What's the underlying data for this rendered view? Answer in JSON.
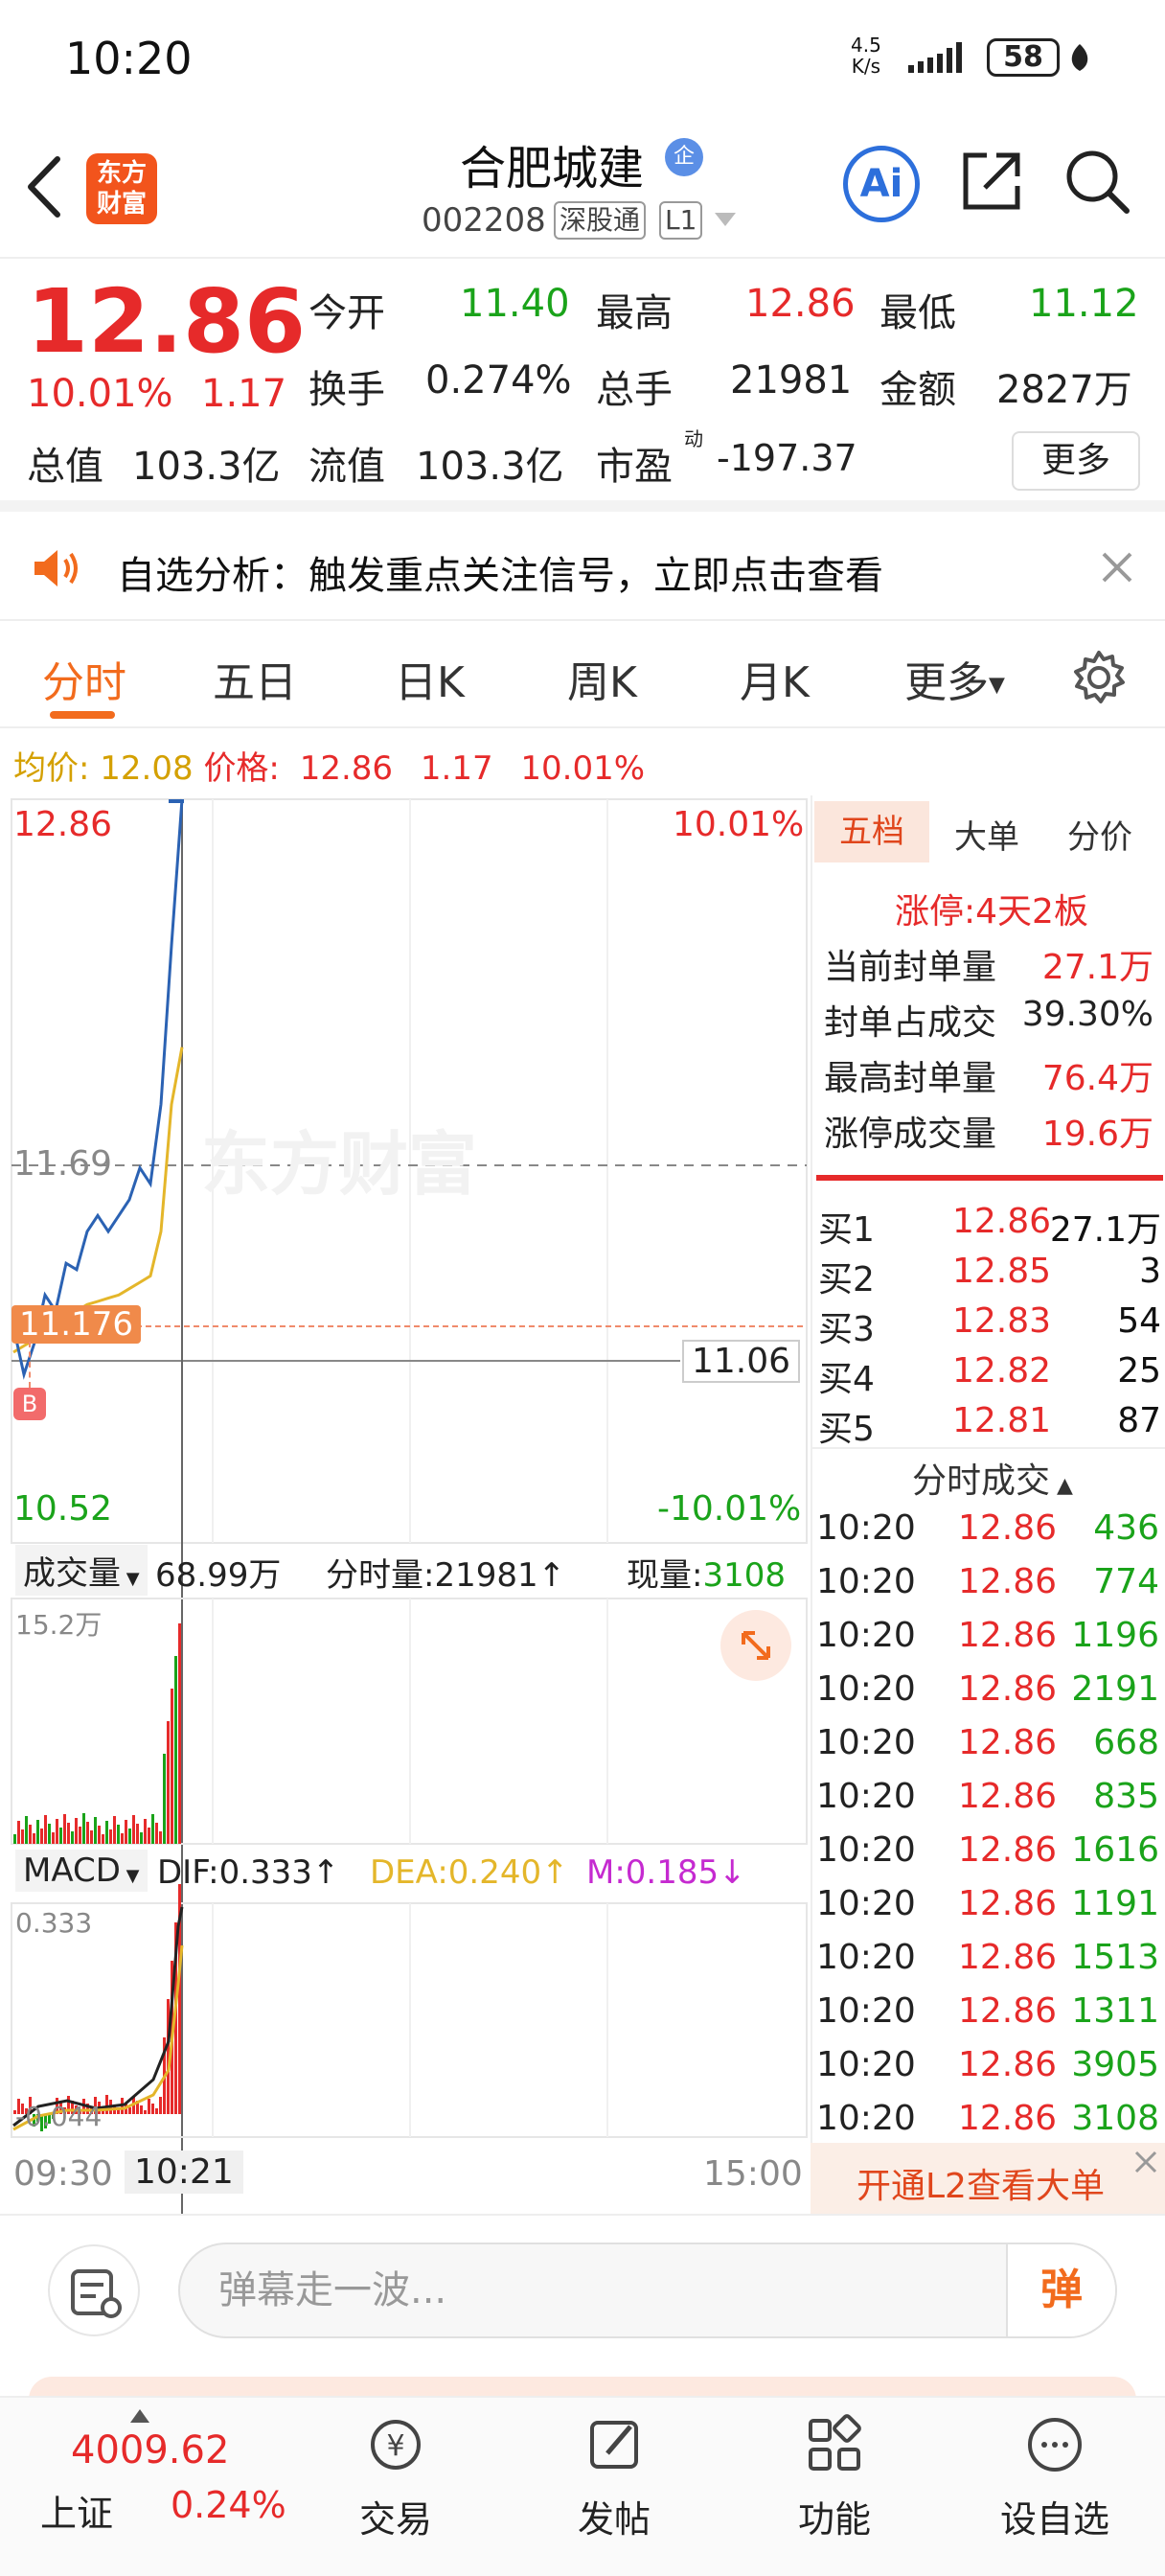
{
  "status_bar": {
    "time": "10:20",
    "net_speed_value": "4.5",
    "net_speed_unit": "K/s",
    "battery": "58"
  },
  "header": {
    "title": "合肥城建",
    "badge": "企",
    "logo_text_line1": "东方",
    "logo_text_line2": "财富",
    "code": "002208",
    "tag1": "深股通",
    "tag2": "L1",
    "ai_label": "Ai"
  },
  "quote": {
    "price": "12.86",
    "change_pct": "10.01%",
    "change": "1.17",
    "fields": {
      "open_label": "今开",
      "open_value": "11.40",
      "high_label": "最高",
      "high_value": "12.86",
      "low_label": "最低",
      "low_value": "11.12",
      "turnover_label": "换手",
      "turnover_value": "0.274%",
      "volume_label": "总手",
      "volume_value": "21981",
      "amount_label": "金额",
      "amount_value": "2827万",
      "total_value_label": "总值",
      "total_value_value": "103.3亿",
      "float_value_label": "流值",
      "float_value_value": "103.3亿",
      "pe_label": "市盈",
      "pe_sup": "动",
      "pe_value": "-197.37"
    },
    "more_button": "更多"
  },
  "notice": {
    "text": "自选分析：触发重点关注信号，立即点击查看"
  },
  "tabs": [
    "分时",
    "五日",
    "日K",
    "周K",
    "月K",
    "更多"
  ],
  "avg_line": {
    "avg_label": "均价:",
    "avg_value": "12.08",
    "price_label": "价格:",
    "price_value": "12.86",
    "chg": "1.17",
    "pct": "10.01%"
  },
  "chart": {
    "price_top": "12.86",
    "pct_top": "10.01%",
    "price_mid": "11.69",
    "price_cursor": "11.176",
    "price_right": "11.06",
    "marker": "B",
    "price_bottom": "10.52",
    "pct_bottom": "-10.01%",
    "watermark": "东方财富",
    "volume_selector": "成交量",
    "volume_total": "68.99万",
    "volume_period_label": "分时量:",
    "volume_period_value": "21981",
    "volume_now_label": "现量:",
    "volume_now_value": "3108",
    "volume_max": "15.2万",
    "macd_selector": "MACD",
    "dif": "DIF:0.333",
    "dea": "DEA:0.240",
    "m": "M:0.185",
    "macd_top": "0.333",
    "macd_bottom": "-0.044",
    "time_start": "09:30",
    "time_cursor": "10:21",
    "time_end": "15:00"
  },
  "chart_data": {
    "type": "line",
    "x_range": [
      "09:30",
      "15:00"
    ],
    "ylim": [
      10.52,
      12.86
    ],
    "price_series_sample": [
      11.2,
      11.05,
      11.15,
      11.3,
      11.25,
      11.4,
      11.38,
      11.5,
      11.55,
      11.5,
      11.55,
      11.6,
      11.7,
      11.65,
      11.9,
      12.4,
      12.86
    ],
    "avg_series_sample": [
      11.12,
      11.14,
      11.16,
      11.2,
      11.22,
      11.24,
      11.25,
      11.27,
      11.28,
      11.29,
      11.3,
      11.32,
      11.34,
      11.36,
      11.5,
      11.9,
      12.08
    ]
  },
  "right_panel": {
    "tabs": [
      "五档",
      "大单",
      "分价"
    ],
    "limit_label": "涨停:",
    "limit_value": "4天2板",
    "stats": [
      {
        "label": "当前封单量",
        "value": "27.1万"
      },
      {
        "label": "封单占成交",
        "value": "39.30%"
      },
      {
        "label": "最高封单量",
        "value": "76.4万"
      },
      {
        "label": "涨停成交量",
        "value": "19.6万"
      }
    ],
    "bids": [
      {
        "label": "买1",
        "price": "12.86",
        "qty": "27.1万"
      },
      {
        "label": "买2",
        "price": "12.85",
        "qty": "3"
      },
      {
        "label": "买3",
        "price": "12.83",
        "qty": "54"
      },
      {
        "label": "买4",
        "price": "12.82",
        "qty": "25"
      },
      {
        "label": "买5",
        "price": "12.81",
        "qty": "87"
      }
    ],
    "trades_title": "分时成交",
    "trades": [
      {
        "time": "10:20",
        "price": "12.86",
        "qty": "436"
      },
      {
        "time": "10:20",
        "price": "12.86",
        "qty": "774"
      },
      {
        "time": "10:20",
        "price": "12.86",
        "qty": "1196"
      },
      {
        "time": "10:20",
        "price": "12.86",
        "qty": "2191"
      },
      {
        "time": "10:20",
        "price": "12.86",
        "qty": "668"
      },
      {
        "time": "10:20",
        "price": "12.86",
        "qty": "835"
      },
      {
        "time": "10:20",
        "price": "12.86",
        "qty": "1616"
      },
      {
        "time": "10:20",
        "price": "12.86",
        "qty": "1191"
      },
      {
        "time": "10:20",
        "price": "12.86",
        "qty": "1513"
      },
      {
        "time": "10:20",
        "price": "12.86",
        "qty": "1311"
      },
      {
        "time": "10:20",
        "price": "12.86",
        "qty": "3905"
      },
      {
        "time": "10:20",
        "price": "12.86",
        "qty": "3108"
      }
    ],
    "promo": "开通L2查看大单"
  },
  "danmaku": {
    "placeholder": "弹幕走一波...",
    "button": "弹"
  },
  "bottom_nav": {
    "index_value": "4009.62",
    "index_name": "上证",
    "index_pct": "0.24%",
    "items": [
      "交易",
      "发帖",
      "功能",
      "设自选"
    ]
  }
}
